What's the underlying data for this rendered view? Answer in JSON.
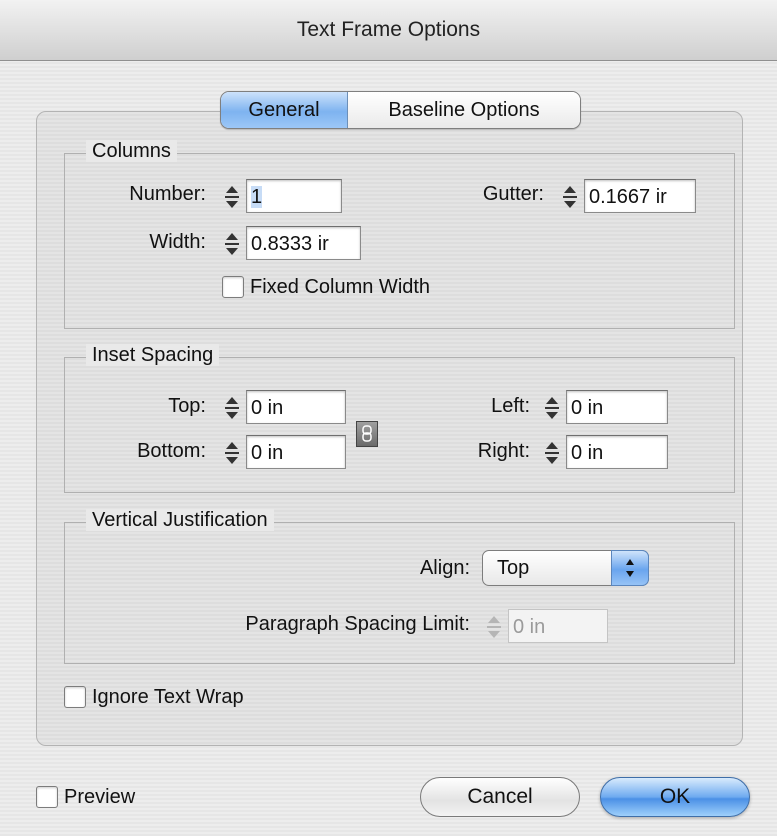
{
  "window": {
    "title": "Text Frame Options"
  },
  "tabs": [
    {
      "label": "General",
      "selected": true
    },
    {
      "label": "Baseline Options",
      "selected": false
    }
  ],
  "columns": {
    "legend": "Columns",
    "number_label": "Number:",
    "number_value": "1",
    "gutter_label": "Gutter:",
    "gutter_value": "0.1667 ir",
    "width_label": "Width:",
    "width_value": "0.8333 ir",
    "fixed_width_label": "Fixed Column Width",
    "fixed_width_checked": false
  },
  "inset": {
    "legend": "Inset Spacing",
    "top_label": "Top:",
    "top_value": "0 in",
    "bottom_label": "Bottom:",
    "bottom_value": "0 in",
    "left_label": "Left:",
    "left_value": "0 in",
    "right_label": "Right:",
    "right_value": "0 in",
    "chain_icon": "chain-link-icon"
  },
  "vertical": {
    "legend": "Vertical Justification",
    "align_label": "Align:",
    "align_value": "Top",
    "para_limit_label": "Paragraph Spacing Limit:",
    "para_limit_value": "0 in",
    "para_limit_enabled": false
  },
  "ignore_wrap": {
    "label": "Ignore Text Wrap",
    "checked": false
  },
  "footer": {
    "preview_label": "Preview",
    "preview_checked": false,
    "cancel_label": "Cancel",
    "ok_label": "OK"
  },
  "colors": {
    "accent": "#6eaaf0",
    "selection": "#c7dcf6"
  }
}
